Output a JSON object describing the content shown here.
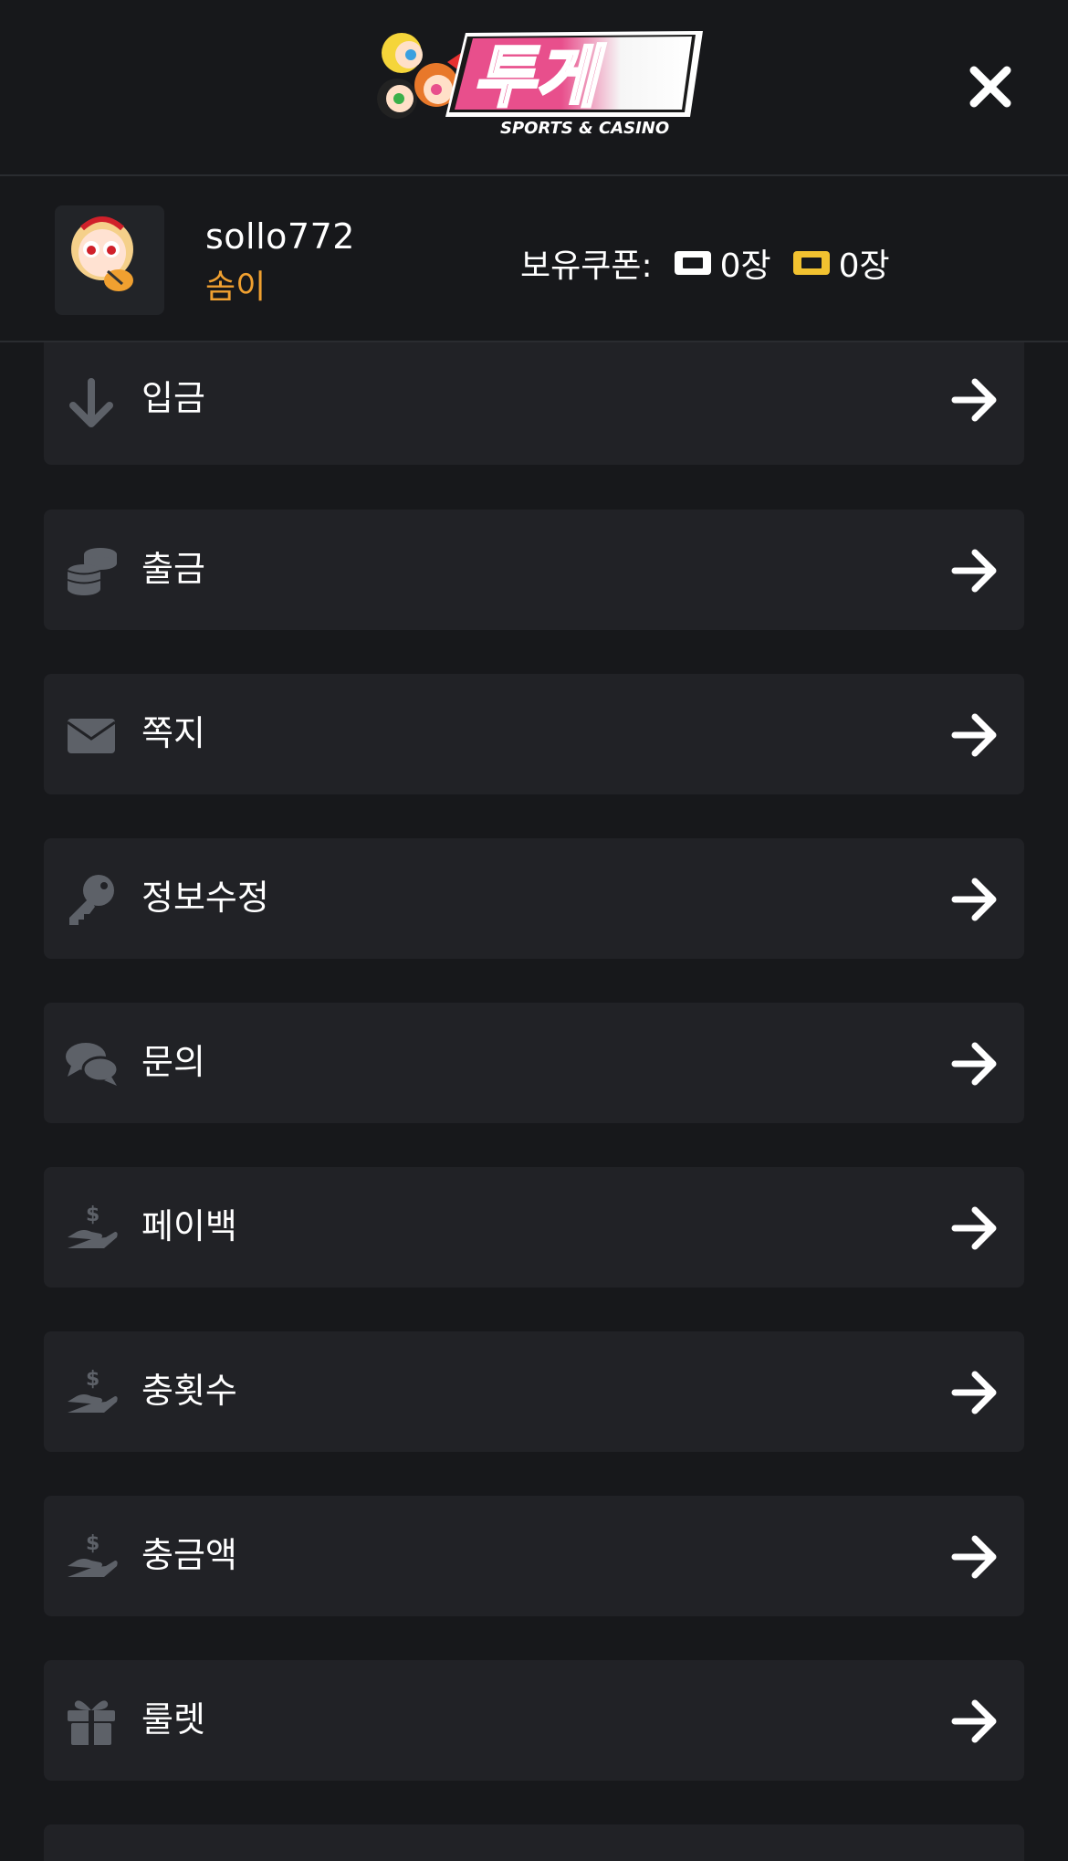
{
  "header": {
    "logo_text": "투게",
    "logo_subtitle": "SPORTS & CASINO"
  },
  "user": {
    "username": "sollo772",
    "nickname": "솜이",
    "coupon_label": "보유쿠폰:",
    "coupon_white_count": "0장",
    "coupon_yellow_count": "0장"
  },
  "colors": {
    "background": "#17181b",
    "card": "#212226",
    "icon_gray": "#5d6168",
    "nickname_orange": "#f0a030",
    "coupon_yellow": "#f2c230",
    "logo_pink": "#e84f8c"
  },
  "menu": {
    "items": [
      {
        "label": "입금",
        "icon": "arrow-down-icon"
      },
      {
        "label": "출금",
        "icon": "coins-icon"
      },
      {
        "label": "쪽지",
        "icon": "envelope-icon"
      },
      {
        "label": "정보수정",
        "icon": "key-icon"
      },
      {
        "label": "문의",
        "icon": "comments-icon"
      },
      {
        "label": "페이백",
        "icon": "hand-dollar-icon"
      },
      {
        "label": "충횟수",
        "icon": "hand-dollar-icon"
      },
      {
        "label": "충금액",
        "icon": "hand-dollar-icon"
      },
      {
        "label": "룰렛",
        "icon": "gift-icon"
      }
    ]
  }
}
